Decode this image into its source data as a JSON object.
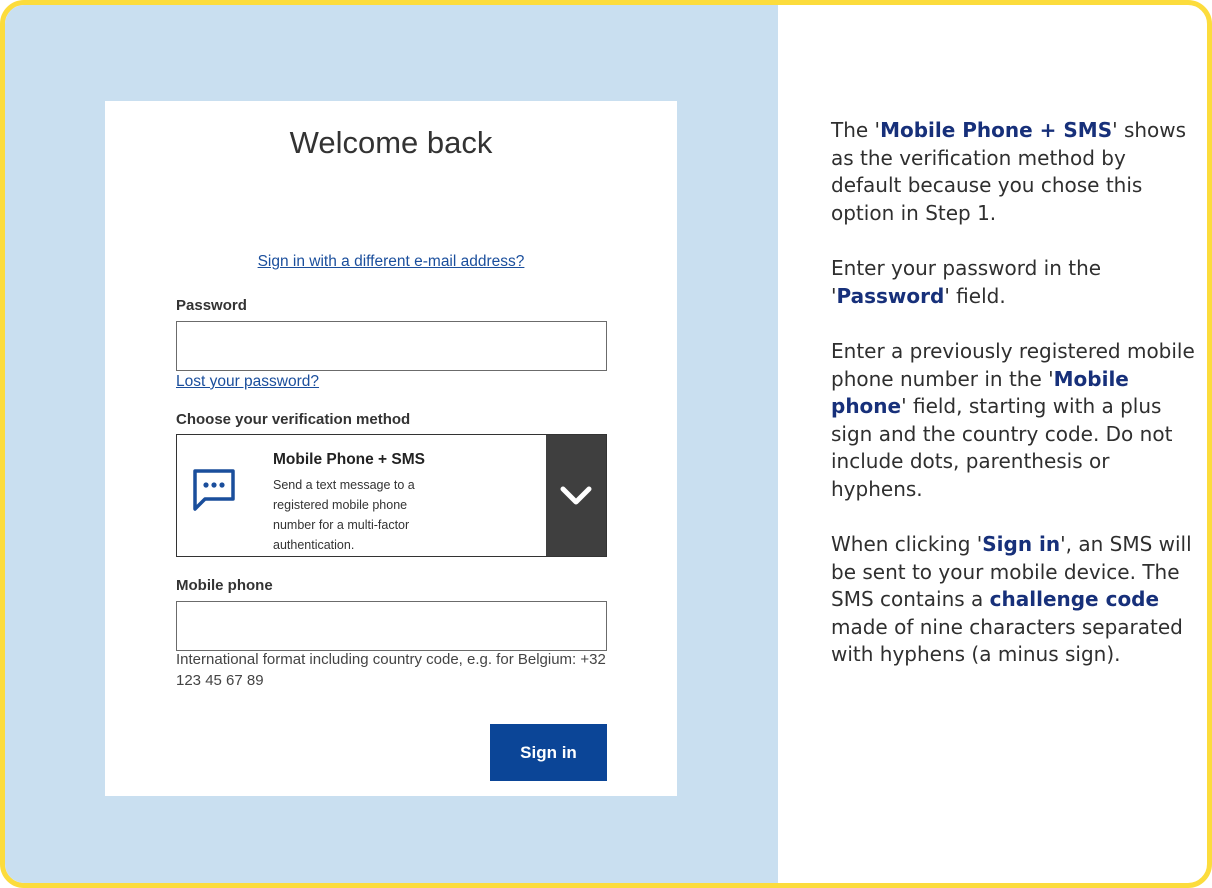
{
  "login_card": {
    "title": "Welcome back",
    "different_email_link": "Sign in with a different e-mail address?",
    "password_label": "Password",
    "password_value": "",
    "lost_password_link": "Lost your password?",
    "verification_label": "Choose your verification method",
    "verification_method": {
      "icon": "sms-chat-bubble-icon",
      "title": "Mobile Phone + SMS",
      "description": "Send a text message to a registered mobile phone number for a multi-factor authentication."
    },
    "mobile_label": "Mobile phone",
    "mobile_value": "",
    "mobile_hint": "International format including country code, e.g. for Belgium: +32 123 45 67 89",
    "sign_in_button": "Sign in"
  },
  "instructions": {
    "p1": {
      "t1": "The '",
      "h1": "Mobile Phone + SMS",
      "t2": "' shows as the verification method by default because you chose this option in Step 1."
    },
    "p2": {
      "t1": "Enter your password in the '",
      "h1": "Password",
      "t2": "' field."
    },
    "p3": {
      "t1": "Enter a previously registered mobile phone number in the '",
      "h1": "Mobile phone",
      "t2": "' field, starting with a plus sign and the country code. Do not include dots, parenthesis or hyphens."
    },
    "p4": {
      "t1": "When clicking '",
      "h1": "Sign in",
      "t2": "', an SMS will be sent to your mobile device. The SMS contains a ",
      "h2": "challenge code",
      "t3": " made of nine characters separated with hyphens (a minus sign)."
    }
  },
  "colors": {
    "frame_border": "#fcdc3c",
    "left_panel_bg": "#c9dff0",
    "primary_button": "#0b4597",
    "link": "#1a4e9c",
    "highlight_text": "#17307a",
    "dropdown_bg": "#3f3f3f"
  }
}
